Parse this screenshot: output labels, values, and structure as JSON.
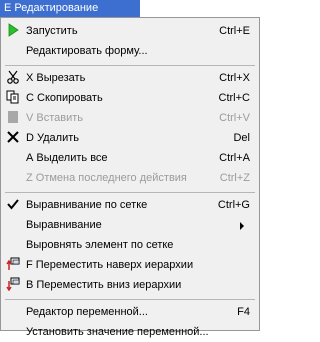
{
  "menu_title": "Е Редактирование",
  "colors": {
    "menubar_active": "#3d6fd0",
    "menu_bg": "#f0f0f0",
    "disabled_text": "#9b9b9b",
    "run_icon": "#2bbf2b",
    "arrow_red": "#cc2222"
  },
  "items": [
    {
      "icon": "play-icon",
      "label": "Запустить",
      "shortcut": "Ctrl+E",
      "enabled": true
    },
    {
      "icon": "",
      "label": "Редактировать форму...",
      "shortcut": "",
      "enabled": true
    },
    {
      "icon": "scissors-icon",
      "label": "Х Вырезать",
      "shortcut": "Ctrl+X",
      "enabled": true
    },
    {
      "icon": "copy-icon",
      "label": "С Скопировать",
      "shortcut": "Ctrl+C",
      "enabled": true
    },
    {
      "icon": "paste-icon",
      "label": "V Вставить",
      "shortcut": "Ctrl+V",
      "enabled": false
    },
    {
      "icon": "delete-x-icon",
      "label": "D Удалить",
      "shortcut": "Del",
      "enabled": true
    },
    {
      "icon": "",
      "label": "А Выделить все",
      "shortcut": "Ctrl+A",
      "enabled": true
    },
    {
      "icon": "",
      "label": "Z Отмена последнего действия",
      "shortcut": "Ctrl+Z",
      "enabled": false
    },
    {
      "icon": "checkmark-icon",
      "label": "Выравнивание по сетке",
      "shortcut": "Ctrl+G",
      "enabled": true
    },
    {
      "icon": "",
      "label": "Выравнивание",
      "shortcut": "",
      "enabled": true,
      "submenu": true
    },
    {
      "icon": "",
      "label": "Выровнять элемент по сетке",
      "shortcut": "",
      "enabled": true
    },
    {
      "icon": "move-up-hierarchy-icon",
      "label": "F Переместить наверх иерархии",
      "shortcut": "",
      "enabled": true
    },
    {
      "icon": "move-down-hierarchy-icon",
      "label": "B Переместить вниз иерархии",
      "shortcut": "",
      "enabled": true
    },
    {
      "icon": "",
      "label": "Редактор переменной...",
      "shortcut": "F4",
      "enabled": true
    },
    {
      "icon": "",
      "label": "Установить значение переменной...",
      "shortcut": "",
      "enabled": true
    }
  ]
}
